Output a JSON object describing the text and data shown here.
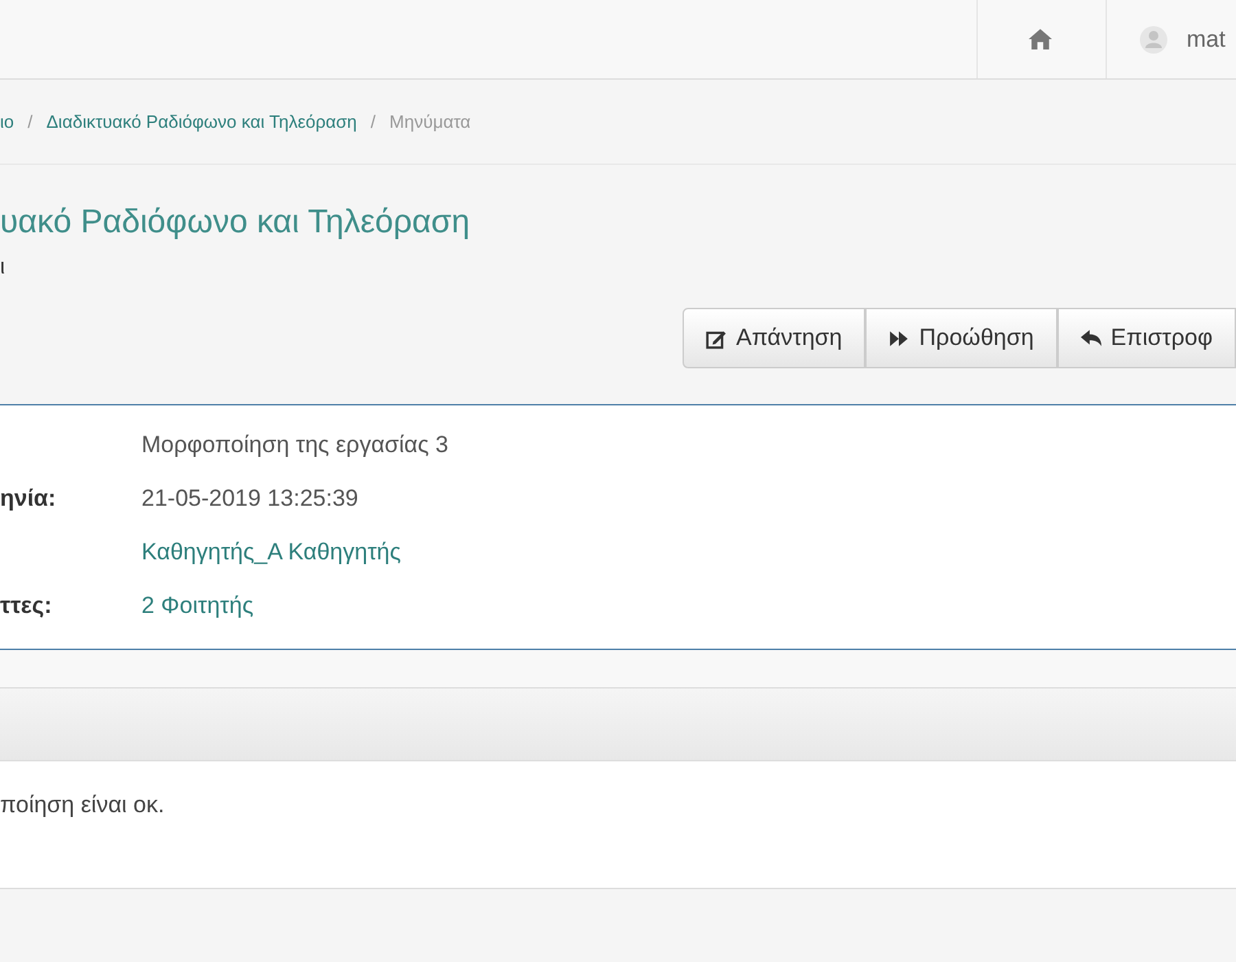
{
  "navbar": {
    "user": "mat"
  },
  "breadcrumb_separators": [
    "/",
    "/"
  ],
  "breadcrumb": [
    {
      "label": "ιο",
      "kind": "link"
    },
    {
      "label": "Διαδικτυακό Ραδιόφωνο και Τηλεόραση",
      "kind": "link"
    },
    {
      "label": "Μηνύματα",
      "kind": "current"
    }
  ],
  "page": {
    "title": "υακό Ραδιόφωνο και Τηλεόραση",
    "subtitle": "ι"
  },
  "actions": [
    {
      "label": "Απάντηση",
      "kind": "reply"
    },
    {
      "label": "Προώθηση",
      "kind": "forward"
    },
    {
      "label": "Επιστροφ",
      "kind": "back"
    }
  ],
  "details": [
    {
      "value": "Μορφοποίηση της εργασίας 3",
      "kind": "text"
    },
    {
      "label": "ηνία:",
      "value": "21-05-2019 13:25:39",
      "kind": "text"
    },
    {
      "value": "Καθηγητής_Α Καθηγητής",
      "kind": "link"
    },
    {
      "label": "ττες:",
      "value": "2 Φοιτητής",
      "kind": "link"
    }
  ],
  "message": {
    "body": "ποίηση είναι οκ."
  }
}
